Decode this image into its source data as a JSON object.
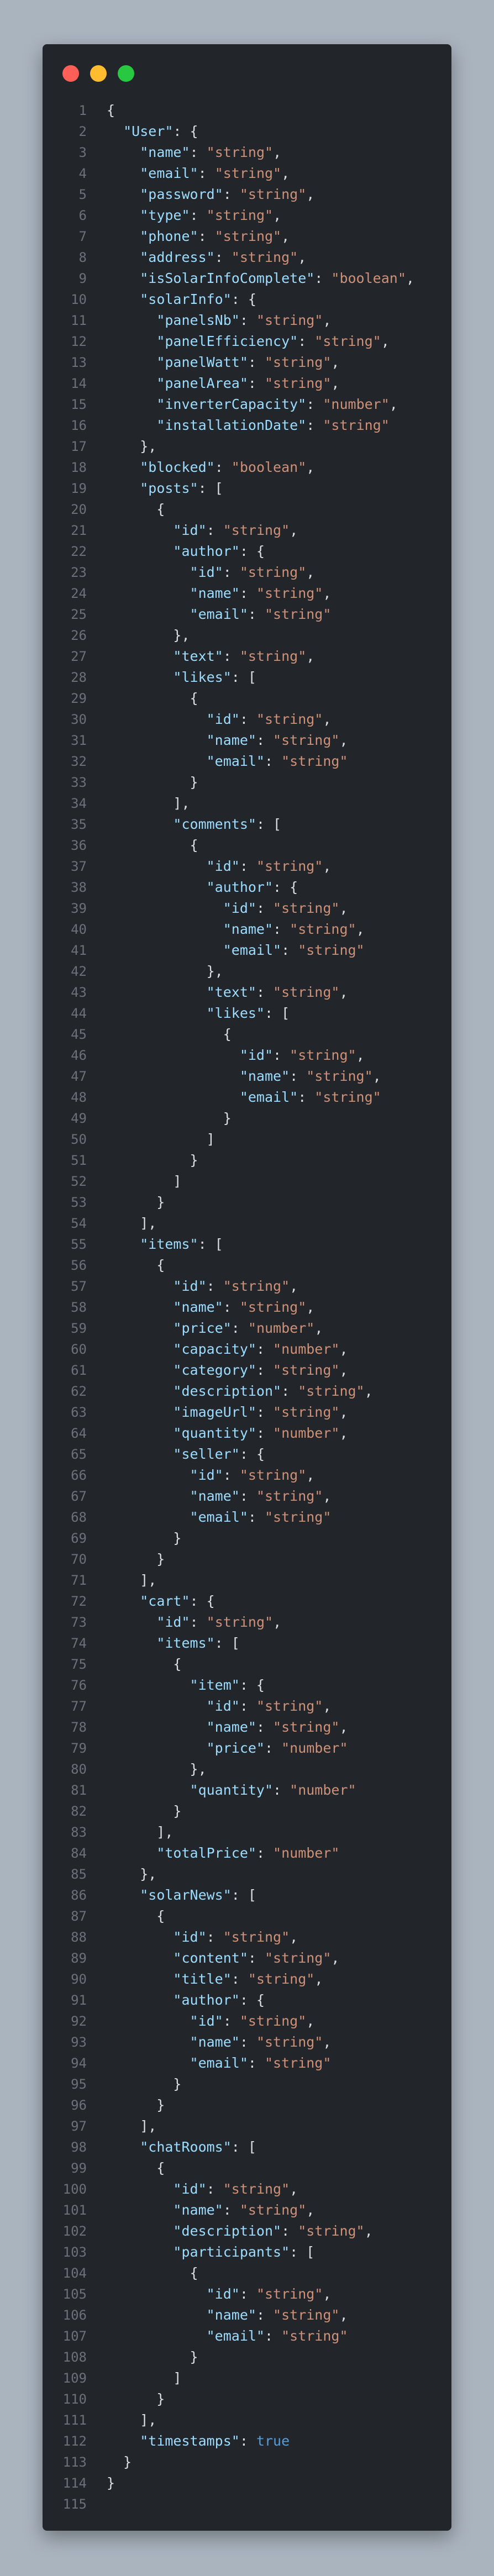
{
  "window": {
    "controls": [
      "close",
      "minimize",
      "maximize"
    ]
  },
  "colors": {
    "background": "#aab4bf",
    "editor": "#22262b",
    "key": "#9cdcfe",
    "string": "#ce9178",
    "keyword": "#569cd6",
    "punctuation": "#dcdfe4",
    "line_number": "#6b7079"
  },
  "editor": {
    "lines": [
      [
        "{"
      ],
      [
        "  ",
        "\"User\"",
        ": {"
      ],
      [
        "    ",
        "\"name\"",
        ": ",
        "\"string\"",
        ","
      ],
      [
        "    ",
        "\"email\"",
        ": ",
        "\"string\"",
        ","
      ],
      [
        "    ",
        "\"password\"",
        ": ",
        "\"string\"",
        ","
      ],
      [
        "    ",
        "\"type\"",
        ": ",
        "\"string\"",
        ","
      ],
      [
        "    ",
        "\"phone\"",
        ": ",
        "\"string\"",
        ","
      ],
      [
        "    ",
        "\"address\"",
        ": ",
        "\"string\"",
        ","
      ],
      [
        "    ",
        "\"isSolarInfoComplete\"",
        ": ",
        "\"boolean\"",
        ","
      ],
      [
        "    ",
        "\"solarInfo\"",
        ": {"
      ],
      [
        "      ",
        "\"panelsNb\"",
        ": ",
        "\"string\"",
        ","
      ],
      [
        "      ",
        "\"panelEfficiency\"",
        ": ",
        "\"string\"",
        ","
      ],
      [
        "      ",
        "\"panelWatt\"",
        ": ",
        "\"string\"",
        ","
      ],
      [
        "      ",
        "\"panelArea\"",
        ": ",
        "\"string\"",
        ","
      ],
      [
        "      ",
        "\"inverterCapacity\"",
        ": ",
        "\"number\"",
        ","
      ],
      [
        "      ",
        "\"installationDate\"",
        ": ",
        "\"string\""
      ],
      [
        "    },"
      ],
      [
        "    ",
        "\"blocked\"",
        ": ",
        "\"boolean\"",
        ","
      ],
      [
        "    ",
        "\"posts\"",
        ": ["
      ],
      [
        "      {"
      ],
      [
        "        ",
        "\"id\"",
        ": ",
        "\"string\"",
        ","
      ],
      [
        "        ",
        "\"author\"",
        ": {"
      ],
      [
        "          ",
        "\"id\"",
        ": ",
        "\"string\"",
        ","
      ],
      [
        "          ",
        "\"name\"",
        ": ",
        "\"string\"",
        ","
      ],
      [
        "          ",
        "\"email\"",
        ": ",
        "\"string\""
      ],
      [
        "        },"
      ],
      [
        "        ",
        "\"text\"",
        ": ",
        "\"string\"",
        ","
      ],
      [
        "        ",
        "\"likes\"",
        ": ["
      ],
      [
        "          {"
      ],
      [
        "            ",
        "\"id\"",
        ": ",
        "\"string\"",
        ","
      ],
      [
        "            ",
        "\"name\"",
        ": ",
        "\"string\"",
        ","
      ],
      [
        "            ",
        "\"email\"",
        ": ",
        "\"string\""
      ],
      [
        "          }"
      ],
      [
        "        ],"
      ],
      [
        "        ",
        "\"comments\"",
        ": ["
      ],
      [
        "          {"
      ],
      [
        "            ",
        "\"id\"",
        ": ",
        "\"string\"",
        ","
      ],
      [
        "            ",
        "\"author\"",
        ": {"
      ],
      [
        "              ",
        "\"id\"",
        ": ",
        "\"string\"",
        ","
      ],
      [
        "              ",
        "\"name\"",
        ": ",
        "\"string\"",
        ","
      ],
      [
        "              ",
        "\"email\"",
        ": ",
        "\"string\""
      ],
      [
        "            },"
      ],
      [
        "            ",
        "\"text\"",
        ": ",
        "\"string\"",
        ","
      ],
      [
        "            ",
        "\"likes\"",
        ": ["
      ],
      [
        "              {"
      ],
      [
        "                ",
        "\"id\"",
        ": ",
        "\"string\"",
        ","
      ],
      [
        "                ",
        "\"name\"",
        ": ",
        "\"string\"",
        ","
      ],
      [
        "                ",
        "\"email\"",
        ": ",
        "\"string\""
      ],
      [
        "              }"
      ],
      [
        "            ]"
      ],
      [
        "          }"
      ],
      [
        "        ]"
      ],
      [
        "      }"
      ],
      [
        "    ],"
      ],
      [
        "    ",
        "\"items\"",
        ": ["
      ],
      [
        "      {"
      ],
      [
        "        ",
        "\"id\"",
        ": ",
        "\"string\"",
        ","
      ],
      [
        "        ",
        "\"name\"",
        ": ",
        "\"string\"",
        ","
      ],
      [
        "        ",
        "\"price\"",
        ": ",
        "\"number\"",
        ","
      ],
      [
        "        ",
        "\"capacity\"",
        ": ",
        "\"number\"",
        ","
      ],
      [
        "        ",
        "\"category\"",
        ": ",
        "\"string\"",
        ","
      ],
      [
        "        ",
        "\"description\"",
        ": ",
        "\"string\"",
        ","
      ],
      [
        "        ",
        "\"imageUrl\"",
        ": ",
        "\"string\"",
        ","
      ],
      [
        "        ",
        "\"quantity\"",
        ": ",
        "\"number\"",
        ","
      ],
      [
        "        ",
        "\"seller\"",
        ": {"
      ],
      [
        "          ",
        "\"id\"",
        ": ",
        "\"string\"",
        ","
      ],
      [
        "          ",
        "\"name\"",
        ": ",
        "\"string\"",
        ","
      ],
      [
        "          ",
        "\"email\"",
        ": ",
        "\"string\""
      ],
      [
        "        }"
      ],
      [
        "      }"
      ],
      [
        "    ],"
      ],
      [
        "    ",
        "\"cart\"",
        ": {"
      ],
      [
        "      ",
        "\"id\"",
        ": ",
        "\"string\"",
        ","
      ],
      [
        "      ",
        "\"items\"",
        ": ["
      ],
      [
        "        {"
      ],
      [
        "          ",
        "\"item\"",
        ": {"
      ],
      [
        "            ",
        "\"id\"",
        ": ",
        "\"string\"",
        ","
      ],
      [
        "            ",
        "\"name\"",
        ": ",
        "\"string\"",
        ","
      ],
      [
        "            ",
        "\"price\"",
        ": ",
        "\"number\""
      ],
      [
        "          },"
      ],
      [
        "          ",
        "\"quantity\"",
        ": ",
        "\"number\""
      ],
      [
        "        }"
      ],
      [
        "      ],"
      ],
      [
        "      ",
        "\"totalPrice\"",
        ": ",
        "\"number\""
      ],
      [
        "    },"
      ],
      [
        "    ",
        "\"solarNews\"",
        ": ["
      ],
      [
        "      {"
      ],
      [
        "        ",
        "\"id\"",
        ": ",
        "\"string\"",
        ","
      ],
      [
        "        ",
        "\"content\"",
        ": ",
        "\"string\"",
        ","
      ],
      [
        "        ",
        "\"title\"",
        ": ",
        "\"string\"",
        ","
      ],
      [
        "        ",
        "\"author\"",
        ": {"
      ],
      [
        "          ",
        "\"id\"",
        ": ",
        "\"string\"",
        ","
      ],
      [
        "          ",
        "\"name\"",
        ": ",
        "\"string\"",
        ","
      ],
      [
        "          ",
        "\"email\"",
        ": ",
        "\"string\""
      ],
      [
        "        }"
      ],
      [
        "      }"
      ],
      [
        "    ],"
      ],
      [
        "    ",
        "\"chatRooms\"",
        ": ["
      ],
      [
        "      {"
      ],
      [
        "        ",
        "\"id\"",
        ": ",
        "\"string\"",
        ","
      ],
      [
        "        ",
        "\"name\"",
        ": ",
        "\"string\"",
        ","
      ],
      [
        "        ",
        "\"description\"",
        ": ",
        "\"string\"",
        ","
      ],
      [
        "        ",
        "\"participants\"",
        ": ["
      ],
      [
        "          {"
      ],
      [
        "            ",
        "\"id\"",
        ": ",
        "\"string\"",
        ","
      ],
      [
        "            ",
        "\"name\"",
        ": ",
        "\"string\"",
        ","
      ],
      [
        "            ",
        "\"email\"",
        ": ",
        "\"string\""
      ],
      [
        "          }"
      ],
      [
        "        ]"
      ],
      [
        "      }"
      ],
      [
        "    ],"
      ],
      [
        "    ",
        "\"timestamps\"",
        ": ",
        "true"
      ],
      [
        "  }"
      ],
      [
        "}"
      ],
      [
        ""
      ]
    ]
  }
}
